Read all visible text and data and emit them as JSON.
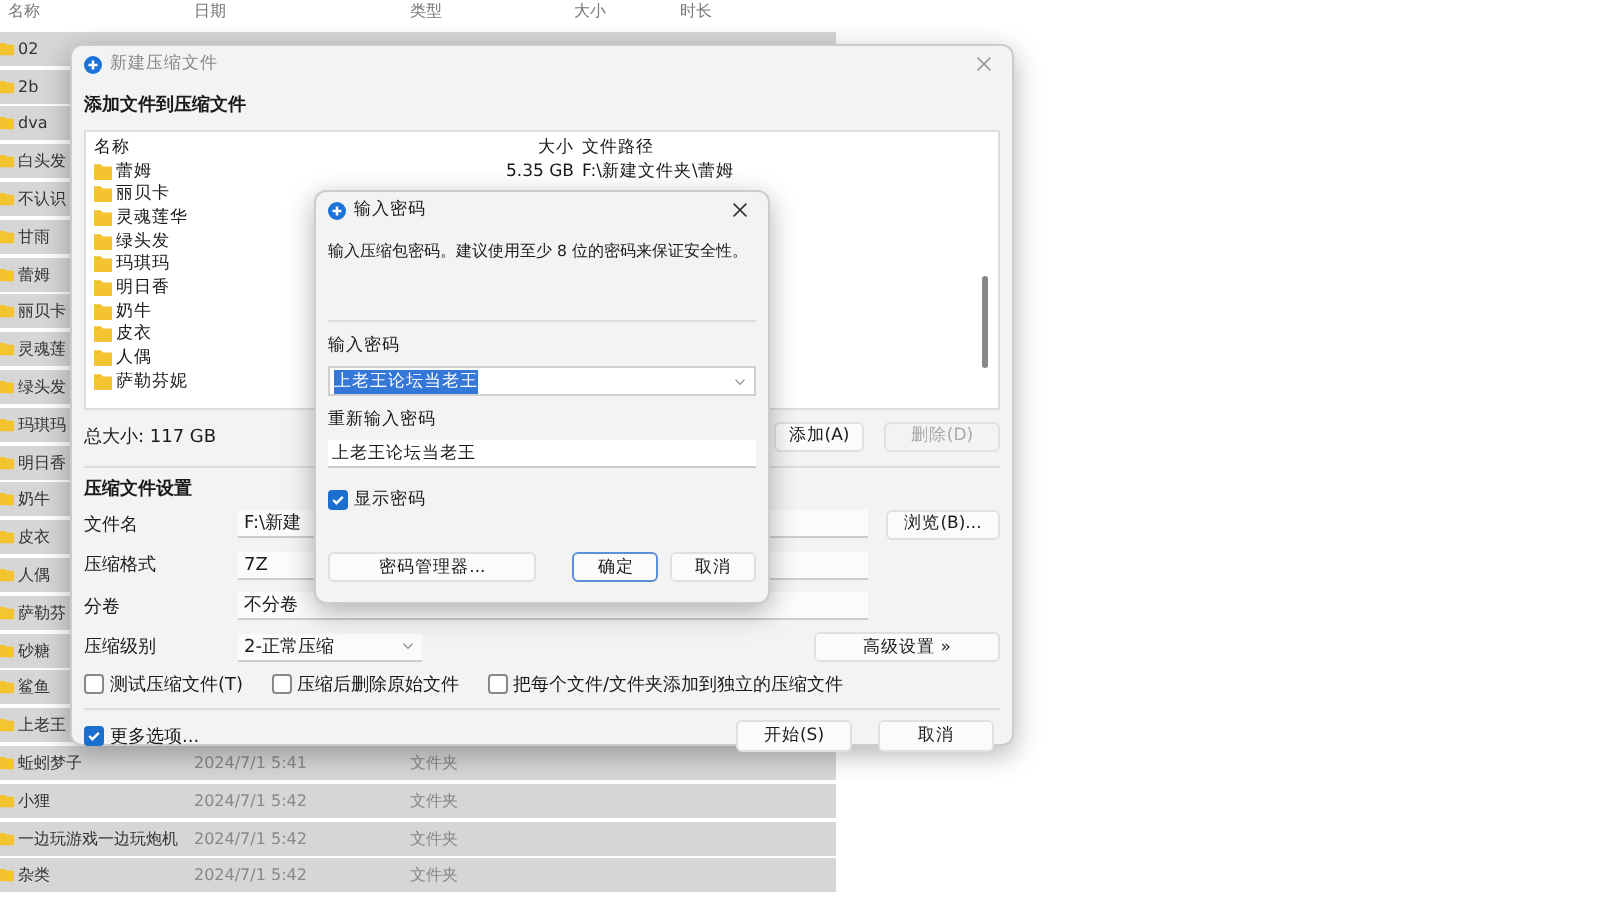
{
  "file_list": {
    "columns": [
      "名称",
      "日期",
      "类型",
      "大小",
      "时长"
    ],
    "rows": [
      {
        "name": "02"
      },
      {
        "name": "2b"
      },
      {
        "name": "dva"
      },
      {
        "name": "白头发"
      },
      {
        "name": "不认识"
      },
      {
        "name": "甘雨"
      },
      {
        "name": "蕾姆"
      },
      {
        "name": "丽贝卡"
      },
      {
        "name": "灵魂莲"
      },
      {
        "name": "绿头发"
      },
      {
        "name": "玛琪玛"
      },
      {
        "name": "明日香"
      },
      {
        "name": "奶牛"
      },
      {
        "name": "皮衣"
      },
      {
        "name": "人偶"
      },
      {
        "name": "萨勒芬"
      },
      {
        "name": "砂糖"
      },
      {
        "name": "鲨鱼"
      },
      {
        "name": "上老王"
      },
      {
        "name": "蚯蚓梦子",
        "date": "2024/7/1 5:41",
        "type": "文件夹"
      },
      {
        "name": "小狸",
        "date": "2024/7/1 5:42",
        "type": "文件夹"
      },
      {
        "name": "一边玩游戏一边玩炮机",
        "date": "2024/7/1 5:42",
        "type": "文件夹"
      },
      {
        "name": "杂类",
        "date": "2024/7/1 5:42",
        "type": "文件夹"
      }
    ]
  },
  "main_dialog": {
    "title": "新建压缩文件",
    "heading": "添加文件到压缩文件",
    "files": {
      "columns": [
        "名称",
        "大小",
        "文件路径"
      ],
      "rows": [
        {
          "name": "蕾姆",
          "size": "5.35 GB",
          "path": "F:\\新建文件夹\\蕾姆"
        },
        {
          "name": "丽贝卡"
        },
        {
          "name": "灵魂莲华"
        },
        {
          "name": "绿头发"
        },
        {
          "name": "玛琪玛"
        },
        {
          "name": "明日香"
        },
        {
          "name": "奶牛"
        },
        {
          "name": "皮衣"
        },
        {
          "name": "人偶"
        },
        {
          "name": "萨勒芬妮"
        }
      ]
    },
    "total": "总大小: 117 GB",
    "add_button": {
      "label": "添加(A)",
      "disabled": false
    },
    "delete_button": {
      "label": "删除(D)",
      "disabled": true
    },
    "settings_heading": "压缩文件设置",
    "fields": [
      {
        "label": "文件名",
        "value": "F:\\新建",
        "kind": "text",
        "button": "浏览(B)..."
      },
      {
        "label": "压缩格式",
        "value": "7Z",
        "kind": "text"
      },
      {
        "label": "分卷",
        "value": "不分卷",
        "kind": "text"
      },
      {
        "label": "压缩级别",
        "value": "2-正常压缩",
        "kind": "dropdown",
        "button": "高级设置 »"
      }
    ],
    "options": [
      {
        "label": "测试压缩文件(T)",
        "checked": false
      },
      {
        "label": "压缩后删除原始文件",
        "checked": false
      },
      {
        "label": "把每个文件/文件夹添加到独立的压缩文件",
        "checked": false
      }
    ],
    "more_options": {
      "label": "更多选项...",
      "checked": true
    },
    "start_button": "开始(S)",
    "cancel_button": "取消"
  },
  "password_dialog": {
    "title": "输入密码",
    "description": "输入压缩包密码。建议使用至少 8 位的密码来保证安全性。",
    "password_label": "输入密码",
    "password_value": "上老王论坛当老王",
    "repeat_label": "重新输入密码",
    "repeat_value": "上老王论坛当老王",
    "show_password": {
      "label": "显示密码",
      "checked": true
    },
    "buttons": [
      {
        "label": "密码管理器...",
        "kind": "wide",
        "selected": false
      },
      {
        "label": "确定",
        "kind": "normal",
        "selected": true
      },
      {
        "label": "取消",
        "kind": "normal",
        "selected": false
      }
    ]
  }
}
